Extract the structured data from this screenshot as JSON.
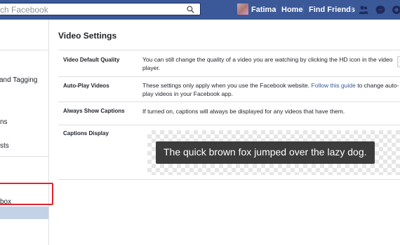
{
  "topbar": {
    "search_placeholder": "ch Facebook",
    "user_name": "Fatima",
    "home_label": "Home",
    "find_friends_label": "Find Friends",
    "icons": [
      "search-icon",
      "friend-requests-icon",
      "messages-icon",
      "notifications-icon"
    ]
  },
  "sidebar": {
    "items": [
      {
        "label": "and Tagging"
      },
      {
        "label": "ns"
      },
      {
        "label": "sts"
      },
      {
        "label": "box"
      }
    ],
    "active_item": ""
  },
  "settings": {
    "title": "Video Settings",
    "rows": [
      {
        "label": "Video Default Quality",
        "description": "You can still change the quality of a video you are watching by clicking the HD icon in the video player."
      },
      {
        "label": "Auto-Play Videos",
        "description_before": "These settings only apply when you use the Facebook website.",
        "link_text": "Follow this guide",
        "description_after": "to change auto-play videos in your Facebook app."
      },
      {
        "label": "Always Show Captions",
        "description": "If turned on, captions will always be displayed for any videos that have them."
      },
      {
        "label": "Captions Display",
        "caption_preview": "The quick brown fox jumped over the lazy dog."
      }
    ]
  },
  "colors": {
    "brand_blue": "#3b5998",
    "link_blue": "#365899",
    "highlight_red": "#e0242c",
    "active_item_bg": "#c4d2e7",
    "caption_bg": "#3c3c3c"
  }
}
